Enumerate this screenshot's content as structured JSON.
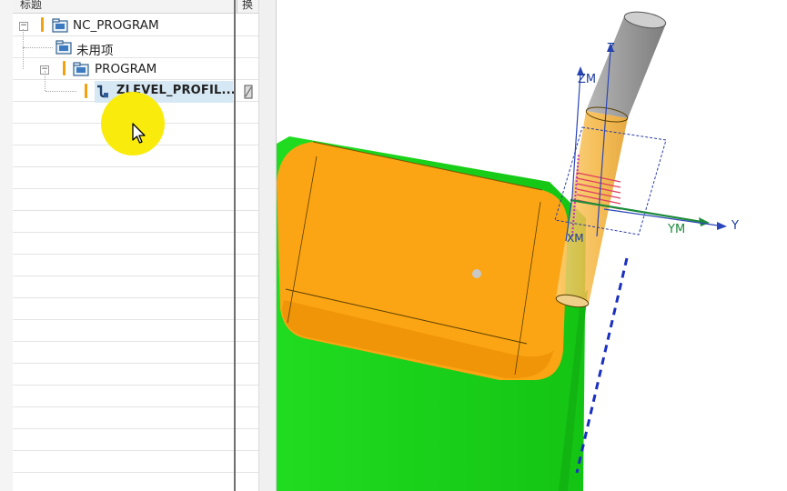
{
  "navigator": {
    "header": {
      "title": "标题",
      "swap": "换"
    },
    "nodes": [
      {
        "label": "NC_PROGRAM"
      },
      {
        "label": "未用项"
      },
      {
        "label": "PROGRAM"
      },
      {
        "label": "ZLEVEL_PROFIL..."
      }
    ]
  },
  "viewport": {
    "axes": {
      "z": "Z",
      "zm": "ZM",
      "y": "Y",
      "ym": "YM",
      "xm": "XM"
    },
    "colors": {
      "part_top": "#fba514",
      "part_side": "#20dc20",
      "tool_shank": "#9e9e9e",
      "tool_cutter": "#f8ba43",
      "axis_blue": "#2b46b8",
      "axis_green": "#1c8a3a",
      "toolpath": "#e04060"
    }
  }
}
